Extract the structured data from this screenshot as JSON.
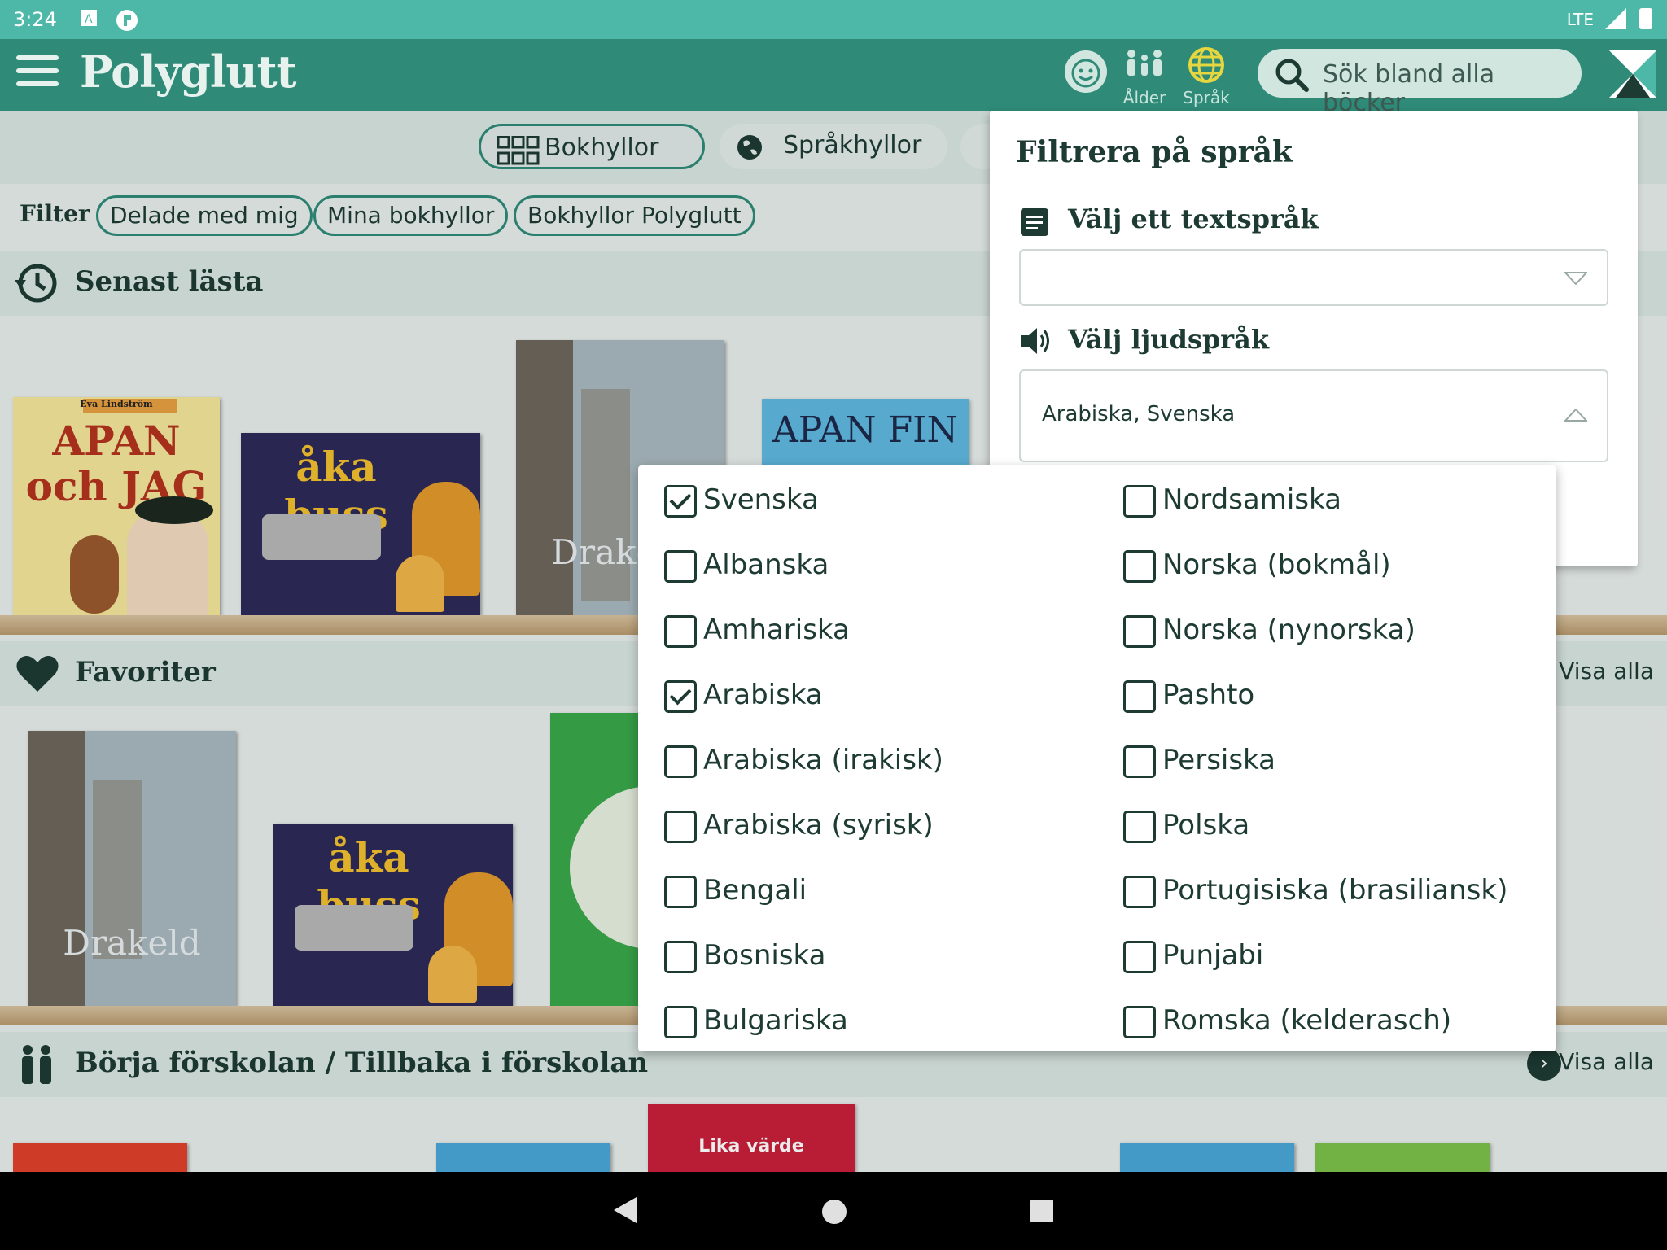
{
  "status_bar": {
    "time": "3:24",
    "network": "LTE"
  },
  "app_bar": {
    "logo": "Polyglutt",
    "age_label": "Ålder",
    "language_label": "Språk",
    "search_placeholder": "Sök bland alla böcker"
  },
  "tabs": [
    {
      "label": "Bokhyllor",
      "icon": "grid-icon",
      "active": true
    },
    {
      "label": "Språkhyllor",
      "icon": "globe-icon",
      "active": false
    }
  ],
  "filter": {
    "label": "Filter",
    "chips": [
      "Delade med mig",
      "Mina bokhyllor",
      "Bokhyllor Polyglutt"
    ]
  },
  "sections": {
    "recent": {
      "title": "Senast lästa"
    },
    "favorites": {
      "title": "Favoriter",
      "view_all": "Visa alla"
    },
    "preschool": {
      "title": "Börja förskolan / Tillbaka i förskolan",
      "view_all": "Visa alla"
    }
  },
  "books": {
    "apan_och_jag": {
      "title": "APAN och JAG",
      "author": "Eva Lindström"
    },
    "aka_buss": {
      "title": "åka buss"
    },
    "drakeld": {
      "title": "Drakeld"
    },
    "apan_fin": {
      "title": "APAN FIN"
    },
    "lika_varde": {
      "title": "Lika värde"
    }
  },
  "language_filter": {
    "title": "Filtrera på språk",
    "text_language_label": "Välj ett textspråk",
    "text_language_value": "",
    "audio_language_label": "Välj ljudspråk",
    "audio_language_value": "Arabiska, Svenska"
  },
  "language_options": {
    "left": [
      {
        "label": "Svenska",
        "checked": true
      },
      {
        "label": "Albanska",
        "checked": false
      },
      {
        "label": "Amhariska",
        "checked": false
      },
      {
        "label": "Arabiska",
        "checked": true
      },
      {
        "label": "Arabiska (irakisk)",
        "checked": false
      },
      {
        "label": "Arabiska (syrisk)",
        "checked": false
      },
      {
        "label": "Bengali",
        "checked": false
      },
      {
        "label": "Bosniska",
        "checked": false
      },
      {
        "label": "Bulgariska",
        "checked": false
      }
    ],
    "right": [
      {
        "label": "Nordsamiska",
        "checked": false
      },
      {
        "label": "Norska (bokmål)",
        "checked": false
      },
      {
        "label": "Norska (nynorska)",
        "checked": false
      },
      {
        "label": "Pashto",
        "checked": false
      },
      {
        "label": "Persiska",
        "checked": false
      },
      {
        "label": "Polska",
        "checked": false
      },
      {
        "label": "Portugisiska (brasiliansk)",
        "checked": false
      },
      {
        "label": "Punjabi",
        "checked": false
      },
      {
        "label": "Romska (kelderasch)",
        "checked": false
      }
    ]
  },
  "colors": {
    "status_bar": "#4db8a8",
    "app_bar": "#2f8a78",
    "text_dark": "#1d3b33"
  }
}
